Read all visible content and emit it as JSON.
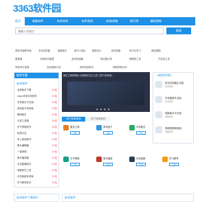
{
  "logo": {
    "text": "3363软件园",
    "sub": "WWW.3363.CC"
  },
  "nav": [
    "首页",
    "电脑软件",
    "安卓软件",
    "安卓游戏",
    "新闻攻略",
    "排行榜",
    "最新更新"
  ],
  "search": {
    "placeholder": "请输入关键字",
    "button": "搜索"
  },
  "hot_row1": [
    "草堂书画教学版",
    "手机浏览器",
    "魔兽助手",
    "数字人图片",
    "图表设计",
    "网页收集",
    "电子化学习",
    "微信看图"
  ],
  "hot_row2": [
    "看直播",
    "万能软件管理",
    "游戏加速器",
    "笔记备忘录",
    "课程表工具",
    "开发者工具"
  ],
  "hot_row3": [
    "驾校考试宝典",
    "全民健身计划",
    "网络流量助手",
    "视频剪辑大师"
  ],
  "banner": {
    "title": "魔法之城特别版 (全新版本正式上线 立即下载体验)"
  },
  "left_box": {
    "head": "推荐专题",
    "sub_head": "安卓软件",
    "items": [
      {
        "name": "全新版本下载",
        "num": "12位"
      },
      {
        "name": "aapp安卓手机软件",
        "num": "12位"
      },
      {
        "name": "手机助手中文版",
        "num": "12位"
      },
      {
        "name": "游戏盒子安卓版",
        "num": "12位"
      },
      {
        "name": "联网助手",
        "num": "11位"
      },
      {
        "name": "日常工具箱",
        "num": "11位"
      },
      {
        "name": "天气预报软件",
        "num": "11位"
      },
      {
        "name": "影视大全",
        "num": "11位"
      },
      {
        "name": "掌上阅读软件",
        "num": "11位"
      },
      {
        "name": "照片编辑器",
        "num": "11位"
      },
      {
        "name": "一键清理",
        "num": "11位"
      },
      {
        "name": "音乐播放器",
        "num": "11位"
      },
      {
        "name": "手机直播软件",
        "num": "11位"
      },
      {
        "name": "电脑软件工具",
        "num": "11位"
      },
      {
        "name": "手机相册安卓版",
        "num": "11位"
      },
      {
        "name": "学习教育软件",
        "num": "11位"
      }
    ]
  },
  "tabs": [
    "热门安卓游戏",
    "热门安卓软件"
  ],
  "apps": [
    {
      "name": "魔法之城",
      "btn": "下载",
      "color": "#e67e22"
    },
    {
      "name": "游戏盒子",
      "btn": "下载",
      "color": "#3498db"
    },
    {
      "name": "手机助手",
      "btn": "下载",
      "color": "#27ae60"
    },
    {
      "name": "影视大全",
      "btn": "下载",
      "color": "#8e44ad"
    },
    {
      "name": "天气预报",
      "btn": "下载",
      "color": "#16a085"
    },
    {
      "name": "音乐播放",
      "btn": "下载",
      "color": "#c0392b"
    },
    {
      "name": "手机相册",
      "btn": "下载",
      "color": "#2c3e50"
    },
    {
      "name": "学习教育",
      "btn": "下载",
      "color": "#f39c12"
    }
  ],
  "right_box": {
    "head": "一周软件排行",
    "cards": [
      {
        "name": "安全浏览器正式版",
        "meta": "安卓软件"
      },
      {
        "name": "手机管家专业版",
        "meta": "安卓软件"
      },
      {
        "name": "电脑助手中文版",
        "meta": "电脑软件"
      },
      {
        "name": "视频剪辑精简版",
        "meta": "电脑软件"
      }
    ]
  },
  "bottom": [
    "安卓软件下载排行",
    "安卓软件"
  ]
}
